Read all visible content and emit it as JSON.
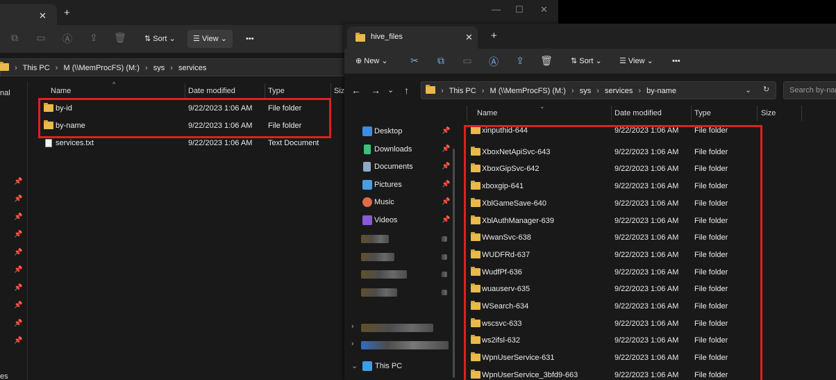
{
  "left_window": {
    "toolbar": {
      "sort_label": "Sort",
      "view_label": "View",
      "more_label": "•••"
    },
    "breadcrumbs": [
      "This PC",
      "M (\\\\MemProcFS) (M:)",
      "sys",
      "services"
    ],
    "nav_label_top": "nal",
    "nav_label_bottom": "es",
    "columns": {
      "name": "Name",
      "date": "Date modified",
      "type": "Type",
      "size": "Size"
    },
    "rows": [
      {
        "name": "by-id",
        "date": "9/22/2023 1:06 AM",
        "type": "File folder",
        "icon": "folder-icon"
      },
      {
        "name": "by-name",
        "date": "9/22/2023 1:06 AM",
        "type": "File folder",
        "icon": "folder-icon"
      },
      {
        "name": "services.txt",
        "date": "9/22/2023 1:06 AM",
        "type": "Text Document",
        "icon": "text-file-icon"
      }
    ]
  },
  "right_window": {
    "tab_title": "hive_files",
    "toolbar": {
      "new_label": "New",
      "sort_label": "Sort",
      "view_label": "View",
      "more_label": "•••"
    },
    "breadcrumbs": [
      "This PC",
      "M (\\\\MemProcFS) (M:)",
      "sys",
      "services",
      "by-name"
    ],
    "search_placeholder": "Search by-name",
    "columns": {
      "name": "Name",
      "date": "Date modified",
      "type": "Type",
      "size": "Size"
    },
    "nav": [
      {
        "label": "Desktop",
        "icon": "desktop-icon",
        "color": "#3a8ee6"
      },
      {
        "label": "Downloads",
        "icon": "download-icon",
        "color": "#3fbf7f"
      },
      {
        "label": "Documents",
        "icon": "documents-icon",
        "color": "#8fa8c8"
      },
      {
        "label": "Pictures",
        "icon": "pictures-icon",
        "color": "#4a9de0"
      },
      {
        "label": "Music",
        "icon": "music-icon",
        "color": "#e06a4a"
      },
      {
        "label": "Videos",
        "icon": "videos-icon",
        "color": "#8a5ad8"
      }
    ],
    "this_pc_label": "This PC",
    "rows": [
      {
        "name": "xinputhid-644",
        "date": "9/22/2023 1:06 AM",
        "type": "File folder"
      },
      {
        "name": "XboxNetApiSvc-643",
        "date": "9/22/2023 1:06 AM",
        "type": "File folder"
      },
      {
        "name": "XboxGipSvc-642",
        "date": "9/22/2023 1:06 AM",
        "type": "File folder"
      },
      {
        "name": "xboxgip-641",
        "date": "9/22/2023 1:06 AM",
        "type": "File folder"
      },
      {
        "name": "XblGameSave-640",
        "date": "9/22/2023 1:06 AM",
        "type": "File folder"
      },
      {
        "name": "XblAuthManager-639",
        "date": "9/22/2023 1:06 AM",
        "type": "File folder"
      },
      {
        "name": "WwanSvc-638",
        "date": "9/22/2023 1:06 AM",
        "type": "File folder"
      },
      {
        "name": "WUDFRd-637",
        "date": "9/22/2023 1:06 AM",
        "type": "File folder"
      },
      {
        "name": "WudfPf-636",
        "date": "9/22/2023 1:06 AM",
        "type": "File folder"
      },
      {
        "name": "wuauserv-635",
        "date": "9/22/2023 1:06 AM",
        "type": "File folder"
      },
      {
        "name": "WSearch-634",
        "date": "9/22/2023 1:06 AM",
        "type": "File folder"
      },
      {
        "name": "wscsvc-633",
        "date": "9/22/2023 1:06 AM",
        "type": "File folder"
      },
      {
        "name": "ws2ifsl-632",
        "date": "9/22/2023 1:06 AM",
        "type": "File folder"
      },
      {
        "name": "WpnUserService-631",
        "date": "9/22/2023 1:06 AM",
        "type": "File folder"
      },
      {
        "name": "WpnUserService_3bfd9-663",
        "date": "9/22/2023 1:06 AM",
        "type": "File folder"
      }
    ]
  },
  "colors": {
    "highlight": "#e02020",
    "folder": "#e9b949",
    "accent": "#7ab0e8"
  }
}
